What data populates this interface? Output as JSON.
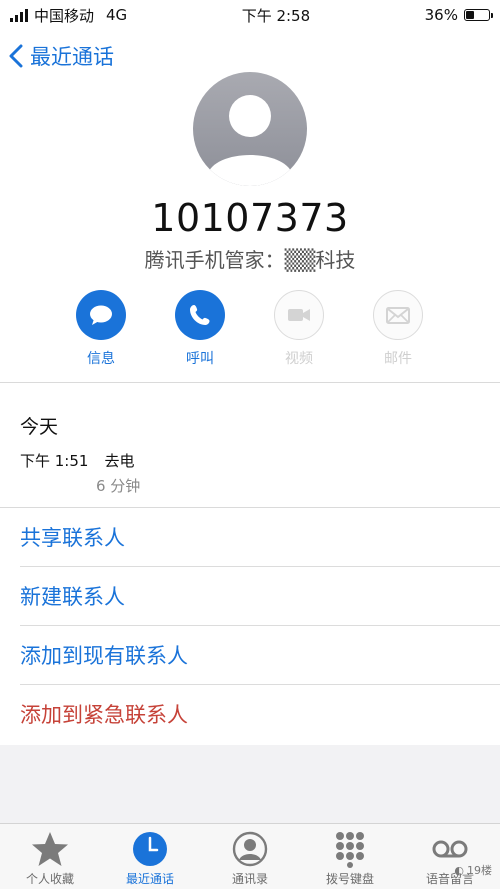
{
  "status_bar": {
    "carrier": "中国移动",
    "network": "4G",
    "time": "下午 2:58",
    "battery": "36%",
    "battery_level": 0.36
  },
  "nav": {
    "back_label": "最近通话"
  },
  "contact": {
    "number": "10107373",
    "label": "腾讯手机管家：▒▒科技"
  },
  "actions": [
    {
      "label": "信息",
      "icon": "message-icon",
      "enabled": true
    },
    {
      "label": "呼叫",
      "icon": "phone-icon",
      "enabled": true
    },
    {
      "label": "视频",
      "icon": "video-icon",
      "enabled": false
    },
    {
      "label": "邮件",
      "icon": "mail-icon",
      "enabled": false
    }
  ],
  "call_log": {
    "header": "今天",
    "entries": [
      {
        "time": "下午 1:51",
        "type": "去电",
        "duration": "6 分钟"
      }
    ]
  },
  "options": [
    {
      "label": "共享联系人"
    },
    {
      "label": "新建联系人"
    },
    {
      "label": "添加到现有联系人"
    },
    {
      "label": "添加到紧急联系人"
    }
  ],
  "tabs": [
    {
      "label": "个人收藏",
      "icon": "star-icon",
      "selected": false
    },
    {
      "label": "最近通话",
      "icon": "clock-icon",
      "selected": true
    },
    {
      "label": "通讯录",
      "icon": "contacts-icon",
      "selected": false
    },
    {
      "label": "拨号键盘",
      "icon": "keypad-icon",
      "selected": false
    },
    {
      "label": "语音留言",
      "icon": "voicemail-icon",
      "selected": false
    }
  ],
  "watermark": {
    "text": "19楼"
  },
  "colors": {
    "accent": "#1a73d9",
    "danger": "#c64238",
    "disabled": "#cfcfcf"
  }
}
